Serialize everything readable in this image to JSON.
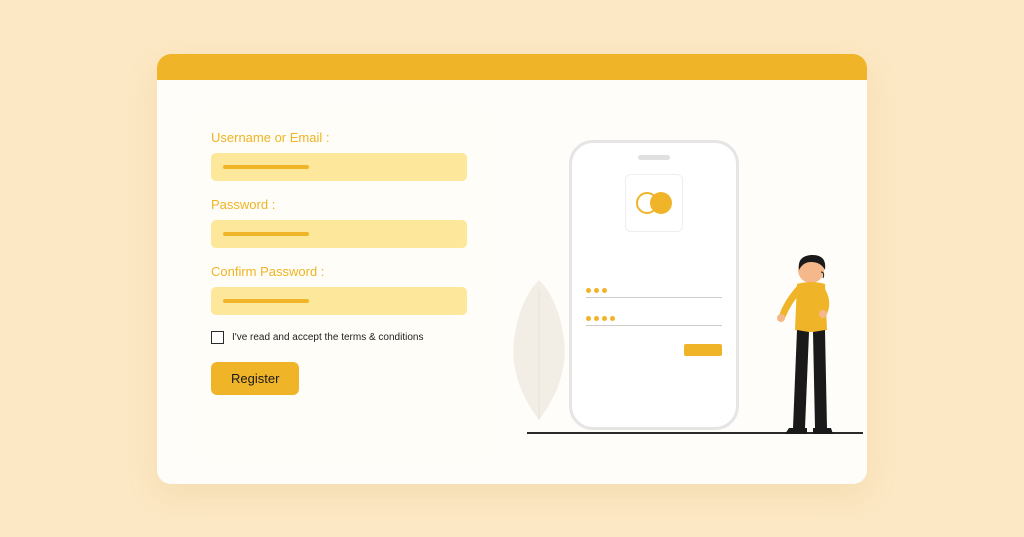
{
  "form": {
    "username_label": "Username or Email :",
    "password_label": "Password :",
    "confirm_label": "Confirm Password :",
    "terms_label": "I've read and accept the terms & conditions",
    "register_label": "Register"
  },
  "colors": {
    "accent": "#f0b429",
    "bg": "#fce8c4"
  }
}
